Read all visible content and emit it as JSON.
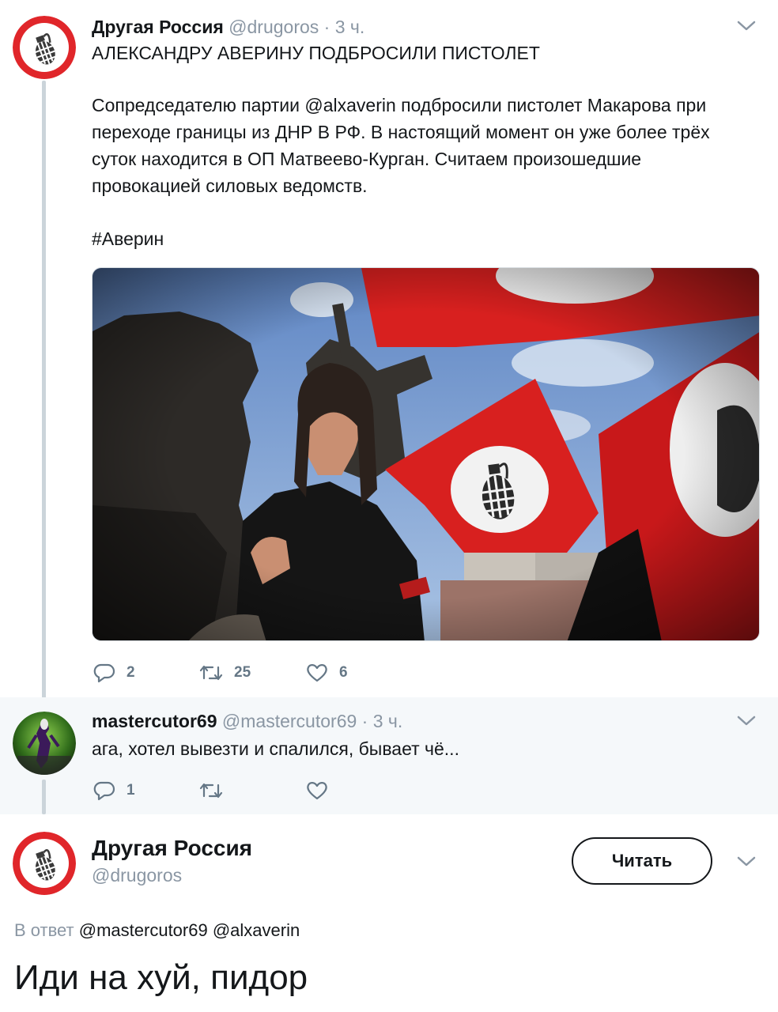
{
  "tweet": {
    "author_name": "Другая Россия",
    "author_handle": "@drugoros",
    "time": "· 3 ч.",
    "headline": "АЛЕКСАНДРУ АВЕРИНУ ПОДБРОСИЛИ ПИСТОЛЕТ",
    "body_lines": [
      "Сопредседателю партии @alxaverin подбросили пистолет Макарова при",
      "переходе границы из ДНР В РФ. В настоящий момент он уже более трёх",
      "суток находится в ОП Матвеево-Курган. Считаем произошедшие",
      "провокацией силовых ведомств."
    ],
    "hashtag": "#Аверин",
    "replies": "2",
    "retweets": "25",
    "likes": "6"
  },
  "reply": {
    "author_name": "mastercutor69",
    "author_handle": "@mastercutor69",
    "time": "· 3 ч.",
    "text": "ага, хотел вывезти и спалился, бывает чё...",
    "replies": "1"
  },
  "main_tweet": {
    "author_name": "Другая Россия",
    "author_handle": "@drugoros",
    "follow_label": "Читать",
    "in_reply_prefix": "В ответ",
    "in_reply_mentions": "@mastercutor69 @alxaverin",
    "text": "Иди на хуй, пидор"
  },
  "icons": {
    "reply": "reply-bubble-icon",
    "retweet": "retweet-icon",
    "like": "heart-icon",
    "menu": "chevron-down-icon"
  },
  "colors": {
    "avatar_ring": "#e0262a",
    "handle_gray": "#8a96a3",
    "action_gray": "#657786",
    "reply_bg": "#f5f8fa",
    "thread_line": "#cbd4da"
  }
}
